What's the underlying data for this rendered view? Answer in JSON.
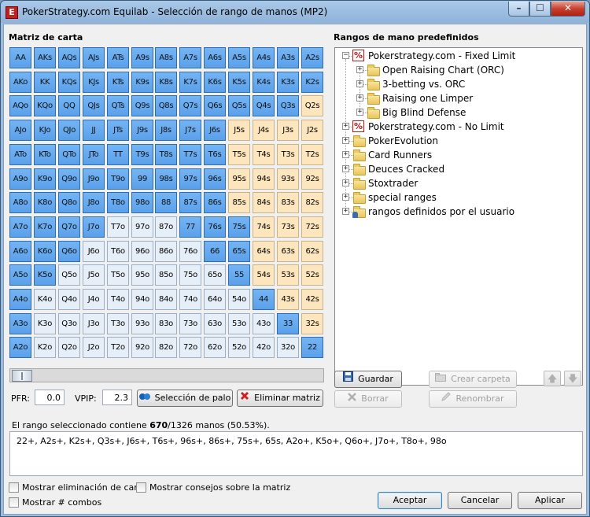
{
  "window": {
    "title": "PokerStrategy.com Equilab - Selección de rango de manos (MP2)",
    "app_icon": "equilab-app-icon",
    "minimize": "–",
    "maximize": "☐",
    "close": "✕"
  },
  "matrix": {
    "label": "Matriz de carta",
    "rows": [
      [
        [
          "AA",
          "sel"
        ],
        [
          "AKs",
          "sel"
        ],
        [
          "AQs",
          "sel"
        ],
        [
          "AJs",
          "sel"
        ],
        [
          "ATs",
          "sel"
        ],
        [
          "A9s",
          "sel"
        ],
        [
          "A8s",
          "sel"
        ],
        [
          "A7s",
          "sel"
        ],
        [
          "A6s",
          "sel"
        ],
        [
          "A5s",
          "sel"
        ],
        [
          "A4s",
          "sel"
        ],
        [
          "A3s",
          "sel"
        ],
        [
          "A2s",
          "sel"
        ]
      ],
      [
        [
          "AKo",
          "sel"
        ],
        [
          "KK",
          "sel"
        ],
        [
          "KQs",
          "sel"
        ],
        [
          "KJs",
          "sel"
        ],
        [
          "KTs",
          "sel"
        ],
        [
          "K9s",
          "sel"
        ],
        [
          "K8s",
          "sel"
        ],
        [
          "K7s",
          "sel"
        ],
        [
          "K6s",
          "sel"
        ],
        [
          "K5s",
          "sel"
        ],
        [
          "K4s",
          "sel"
        ],
        [
          "K3s",
          "sel"
        ],
        [
          "K2s",
          "sel"
        ]
      ],
      [
        [
          "AQo",
          "sel"
        ],
        [
          "KQo",
          "sel"
        ],
        [
          "QQ",
          "sel"
        ],
        [
          "QJs",
          "sel"
        ],
        [
          "QTs",
          "sel"
        ],
        [
          "Q9s",
          "sel"
        ],
        [
          "Q8s",
          "sel"
        ],
        [
          "Q7s",
          "sel"
        ],
        [
          "Q6s",
          "sel"
        ],
        [
          "Q5s",
          "sel"
        ],
        [
          "Q4s",
          "sel"
        ],
        [
          "Q3s",
          "sel"
        ],
        [
          "Q2s",
          "suited"
        ]
      ],
      [
        [
          "AJo",
          "sel"
        ],
        [
          "KJo",
          "sel"
        ],
        [
          "QJo",
          "sel"
        ],
        [
          "JJ",
          "sel"
        ],
        [
          "JTs",
          "sel"
        ],
        [
          "J9s",
          "sel"
        ],
        [
          "J8s",
          "sel"
        ],
        [
          "J7s",
          "sel"
        ],
        [
          "J6s",
          "sel"
        ],
        [
          "J5s",
          "suited"
        ],
        [
          "J4s",
          "suited"
        ],
        [
          "J3s",
          "suited"
        ],
        [
          "J2s",
          "suited"
        ]
      ],
      [
        [
          "ATo",
          "sel"
        ],
        [
          "KTo",
          "sel"
        ],
        [
          "QTo",
          "sel"
        ],
        [
          "JTo",
          "sel"
        ],
        [
          "TT",
          "sel"
        ],
        [
          "T9s",
          "sel"
        ],
        [
          "T8s",
          "sel"
        ],
        [
          "T7s",
          "sel"
        ],
        [
          "T6s",
          "sel"
        ],
        [
          "T5s",
          "suited"
        ],
        [
          "T4s",
          "suited"
        ],
        [
          "T3s",
          "suited"
        ],
        [
          "T2s",
          "suited"
        ]
      ],
      [
        [
          "A9o",
          "sel"
        ],
        [
          "K9o",
          "sel"
        ],
        [
          "Q9o",
          "sel"
        ],
        [
          "J9o",
          "sel"
        ],
        [
          "T9o",
          "sel"
        ],
        [
          "99",
          "sel"
        ],
        [
          "98s",
          "sel"
        ],
        [
          "97s",
          "sel"
        ],
        [
          "96s",
          "sel"
        ],
        [
          "95s",
          "suited"
        ],
        [
          "94s",
          "suited"
        ],
        [
          "93s",
          "suited"
        ],
        [
          "92s",
          "suited"
        ]
      ],
      [
        [
          "A8o",
          "sel"
        ],
        [
          "K8o",
          "sel"
        ],
        [
          "Q8o",
          "sel"
        ],
        [
          "J8o",
          "sel"
        ],
        [
          "T8o",
          "sel"
        ],
        [
          "98o",
          "sel"
        ],
        [
          "88",
          "sel"
        ],
        [
          "87s",
          "sel"
        ],
        [
          "86s",
          "sel"
        ],
        [
          "85s",
          "suited"
        ],
        [
          "84s",
          "suited"
        ],
        [
          "83s",
          "suited"
        ],
        [
          "82s",
          "suited"
        ]
      ],
      [
        [
          "A7o",
          "sel"
        ],
        [
          "K7o",
          "sel"
        ],
        [
          "Q7o",
          "sel"
        ],
        [
          "J7o",
          "sel"
        ],
        [
          "T7o",
          "offsuit"
        ],
        [
          "97o",
          "offsuit"
        ],
        [
          "87o",
          "offsuit"
        ],
        [
          "77",
          "sel"
        ],
        [
          "76s",
          "sel"
        ],
        [
          "75s",
          "sel"
        ],
        [
          "74s",
          "suited"
        ],
        [
          "73s",
          "suited"
        ],
        [
          "72s",
          "suited"
        ]
      ],
      [
        [
          "A6o",
          "sel"
        ],
        [
          "K6o",
          "sel"
        ],
        [
          "Q6o",
          "sel"
        ],
        [
          "J6o",
          "offsuit"
        ],
        [
          "T6o",
          "offsuit"
        ],
        [
          "96o",
          "offsuit"
        ],
        [
          "86o",
          "offsuit"
        ],
        [
          "76o",
          "offsuit"
        ],
        [
          "66",
          "sel"
        ],
        [
          "65s",
          "sel"
        ],
        [
          "64s",
          "suited"
        ],
        [
          "63s",
          "suited"
        ],
        [
          "62s",
          "suited"
        ]
      ],
      [
        [
          "A5o",
          "sel"
        ],
        [
          "K5o",
          "sel"
        ],
        [
          "Q5o",
          "offsuit"
        ],
        [
          "J5o",
          "offsuit"
        ],
        [
          "T5o",
          "offsuit"
        ],
        [
          "95o",
          "offsuit"
        ],
        [
          "85o",
          "offsuit"
        ],
        [
          "75o",
          "offsuit"
        ],
        [
          "65o",
          "offsuit"
        ],
        [
          "55",
          "sel"
        ],
        [
          "54s",
          "suited"
        ],
        [
          "53s",
          "suited"
        ],
        [
          "52s",
          "suited"
        ]
      ],
      [
        [
          "A4o",
          "sel"
        ],
        [
          "K4o",
          "offsuit"
        ],
        [
          "Q4o",
          "offsuit"
        ],
        [
          "J4o",
          "offsuit"
        ],
        [
          "T4o",
          "offsuit"
        ],
        [
          "94o",
          "offsuit"
        ],
        [
          "84o",
          "offsuit"
        ],
        [
          "74o",
          "offsuit"
        ],
        [
          "64o",
          "offsuit"
        ],
        [
          "54o",
          "offsuit"
        ],
        [
          "44",
          "sel"
        ],
        [
          "43s",
          "suited"
        ],
        [
          "42s",
          "suited"
        ]
      ],
      [
        [
          "A3o",
          "sel"
        ],
        [
          "K3o",
          "offsuit"
        ],
        [
          "Q3o",
          "offsuit"
        ],
        [
          "J3o",
          "offsuit"
        ],
        [
          "T3o",
          "offsuit"
        ],
        [
          "93o",
          "offsuit"
        ],
        [
          "83o",
          "offsuit"
        ],
        [
          "73o",
          "offsuit"
        ],
        [
          "63o",
          "offsuit"
        ],
        [
          "53o",
          "offsuit"
        ],
        [
          "43o",
          "offsuit"
        ],
        [
          "33",
          "sel"
        ],
        [
          "32s",
          "suited"
        ]
      ],
      [
        [
          "A2o",
          "sel"
        ],
        [
          "K2o",
          "offsuit"
        ],
        [
          "Q2o",
          "offsuit"
        ],
        [
          "J2o",
          "offsuit"
        ],
        [
          "T2o",
          "offsuit"
        ],
        [
          "92o",
          "offsuit"
        ],
        [
          "82o",
          "offsuit"
        ],
        [
          "72o",
          "offsuit"
        ],
        [
          "62o",
          "offsuit"
        ],
        [
          "52o",
          "offsuit"
        ],
        [
          "42o",
          "offsuit"
        ],
        [
          "32o",
          "offsuit"
        ],
        [
          "22",
          "sel"
        ]
      ]
    ]
  },
  "controls": {
    "pfr_label": "PFR:",
    "pfr_value": "0.0",
    "vpip_label": "VPIP:",
    "vpip_value": "2.3",
    "suit_select_label": "Selección de palo",
    "clear_matrix_label": "Eliminar matriz"
  },
  "ranges": {
    "label": "Rangos de mano predefinidos",
    "save_label": "Guardar",
    "delete_label": "Borrar",
    "create_folder_label": "Crear carpeta",
    "rename_label": "Renombrar",
    "up_arrow": "🡅",
    "down_arrow": "🡇",
    "tree": [
      {
        "label": "Pokerstrategy.com - Fixed Limit",
        "expander": "−",
        "icon": "percent-icon",
        "level": 0
      },
      {
        "label": "Open Raising Chart (ORC)",
        "expander": "+",
        "icon": "folder-icon",
        "level": 1
      },
      {
        "label": "3-betting vs. ORC",
        "expander": "+",
        "icon": "folder-icon",
        "level": 1
      },
      {
        "label": "Raising one Limper",
        "expander": "+",
        "icon": "folder-icon",
        "level": 1
      },
      {
        "label": "Big Blind Defense",
        "expander": "+",
        "icon": "folder-icon",
        "level": 1
      },
      {
        "label": "Pokerstrategy.com - No Limit",
        "expander": "+",
        "icon": "percent-icon",
        "level": 0
      },
      {
        "label": "PokerEvolution",
        "expander": "+",
        "icon": "folder-icon",
        "level": 0
      },
      {
        "label": "Card Runners",
        "expander": "+",
        "icon": "folder-icon",
        "level": 0
      },
      {
        "label": "Deuces Cracked",
        "expander": "+",
        "icon": "folder-icon",
        "level": 0
      },
      {
        "label": "Stoxtrader",
        "expander": "+",
        "icon": "folder-icon",
        "level": 0
      },
      {
        "label": "special ranges",
        "expander": "+",
        "icon": "folder-icon",
        "level": 0
      },
      {
        "label": "rangos definidos por el usuario",
        "expander": "+",
        "icon": "user-folder-icon",
        "level": 0
      }
    ]
  },
  "status": {
    "prefix": "El rango seleccionado contiene ",
    "selected": "670",
    "suffix": "/1326 manos (50.53%)."
  },
  "range_text": "22+, A2s+, K2s+, Q3s+, J6s+, T6s+, 96s+, 86s+, 75s+, 65s, A2o+, K5o+, Q6o+, J7o+, T8o+, 98o",
  "options": {
    "show_card_removal": "Mostrar eliminación de carta",
    "show_matrix_tips": "Mostrar consejos sobre la matriz",
    "show_combos": "Mostrar # combos"
  },
  "footer": {
    "accept_label": "Aceptar",
    "cancel_label": "Cancelar",
    "apply_label": "Aplicar"
  }
}
